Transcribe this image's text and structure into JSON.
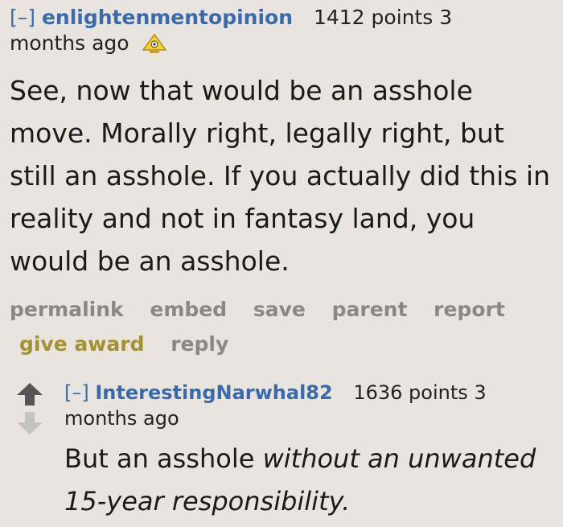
{
  "comment1": {
    "expand": "[–]",
    "author": "enlightenmentopinion",
    "score": "1412 points 3",
    "time": "months ago",
    "award_icon": "gold-award-icon",
    "body": "See, now that would be an asshole move. Morally right, legally right, but still an asshole. If you actually did this in reality and not in fantasy land, you would be an asshole.",
    "buttons": {
      "permalink": "permalink",
      "embed": "embed",
      "save": "save",
      "parent": "parent",
      "report": "report",
      "give_award": "give award",
      "reply": "reply"
    }
  },
  "comment2": {
    "expand": "[–]",
    "author": "InterestingNarwhal82",
    "score": "1636 points 3",
    "time": "months ago",
    "body_plain": "But an asshole ",
    "body_italic": "without an unwanted 15-year responsibility."
  },
  "colors": {
    "background": "#e9e4de",
    "link": "#3b6aa8",
    "button": "#8a8886",
    "gold": "#a39232",
    "upvote": "#555555",
    "downvote": "#c3c3c3"
  }
}
